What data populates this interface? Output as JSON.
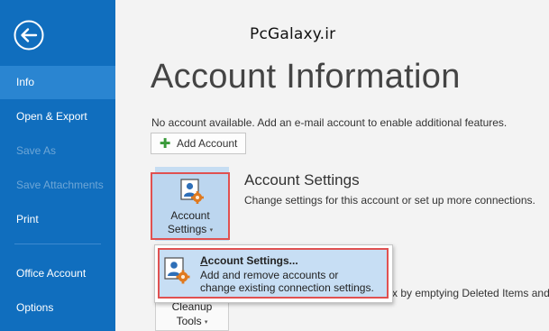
{
  "watermark": "PcGalaxy.ir",
  "nav": {
    "back_label": "Back",
    "items": [
      {
        "label": "Info",
        "state": "active"
      },
      {
        "label": "Open & Export",
        "state": "normal"
      },
      {
        "label": "Save As",
        "state": "disabled"
      },
      {
        "label": "Save Attachments",
        "state": "disabled"
      },
      {
        "label": "Print",
        "state": "normal"
      },
      {
        "label": "Office Account",
        "state": "normal"
      },
      {
        "label": "Options",
        "state": "normal"
      }
    ]
  },
  "main": {
    "title": "Account Information",
    "no_account_text": "No account available. Add an e-mail account to enable additional features.",
    "add_account_label": "Add Account",
    "account_settings": {
      "tile_line1": "Account",
      "tile_line2": "Settings",
      "caret": "▾",
      "heading": "Account Settings",
      "description": "Change settings for this account or set up more connections."
    },
    "cleanup": {
      "line1": "Cleanup",
      "line2": "Tools",
      "caret": "▾",
      "partial_description": "x by emptying Deleted Items and"
    }
  },
  "dropdown": {
    "item": {
      "title_accel": "A",
      "title_rest": "ccount Settings...",
      "desc_line1": "Add and remove accounts or",
      "desc_line2": "change existing connection settings."
    }
  },
  "colors": {
    "nav_bg": "#106ebe",
    "nav_active": "#2a85d1",
    "highlight_border": "#e05151",
    "selection_bg": "#c7def4"
  }
}
